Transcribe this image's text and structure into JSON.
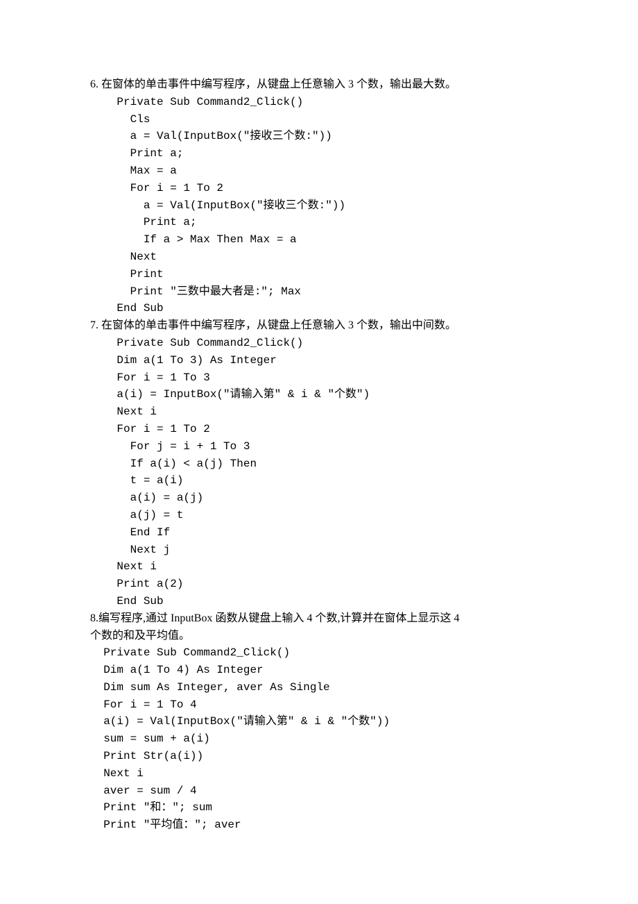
{
  "rows": [
    {
      "indent": 0,
      "cls": "text",
      "text": "6. 在窗体的单击事件中编写程序，从键盘上任意输入 3 个数，输出最大数。"
    },
    {
      "indent": 2,
      "cls": "code",
      "text": "Private Sub Command2_Click()"
    },
    {
      "indent": 3,
      "cls": "code",
      "text": "Cls"
    },
    {
      "indent": 3,
      "cls": "code",
      "text": "a = Val(InputBox(\"接收三个数:\"))"
    },
    {
      "indent": 3,
      "cls": "code",
      "text": "Print a;"
    },
    {
      "indent": 3,
      "cls": "code",
      "text": "Max = a"
    },
    {
      "indent": 3,
      "cls": "code",
      "text": "For i = 1 To 2"
    },
    {
      "indent": 4,
      "cls": "code",
      "text": "a = Val(InputBox(\"接收三个数:\"))"
    },
    {
      "indent": 4,
      "cls": "code",
      "text": "Print a;"
    },
    {
      "indent": 4,
      "cls": "code",
      "text": "If a > Max Then Max = a"
    },
    {
      "indent": 3,
      "cls": "code",
      "text": "Next"
    },
    {
      "indent": 3,
      "cls": "code",
      "text": "Print"
    },
    {
      "indent": 3,
      "cls": "code",
      "text": "Print \"三数中最大者是:\"; Max"
    },
    {
      "indent": 2,
      "cls": "code",
      "text": "End Sub"
    },
    {
      "indent": 0,
      "cls": "text",
      "text": "7. 在窗体的单击事件中编写程序，从键盘上任意输入 3 个数，输出中间数。"
    },
    {
      "indent": 2,
      "cls": "code",
      "text": "Private Sub Command2_Click()"
    },
    {
      "indent": 2,
      "cls": "code",
      "text": "Dim a(1 To 3) As Integer"
    },
    {
      "indent": 2,
      "cls": "code",
      "text": "For i = 1 To 3"
    },
    {
      "indent": 2,
      "cls": "code",
      "text": "a(i) = InputBox(\"请输入第\" & i & \"个数\")"
    },
    {
      "indent": 2,
      "cls": "code",
      "text": "Next i"
    },
    {
      "indent": 2,
      "cls": "code",
      "text": "For i = 1 To 2"
    },
    {
      "indent": 3,
      "cls": "code",
      "text": "For j = i + 1 To 3"
    },
    {
      "indent": 3,
      "cls": "code",
      "text": "If a(i) < a(j) Then"
    },
    {
      "indent": 3,
      "cls": "code",
      "text": "t = a(i)"
    },
    {
      "indent": 3,
      "cls": "code",
      "text": "a(i) = a(j)"
    },
    {
      "indent": 3,
      "cls": "code",
      "text": "a(j) = t"
    },
    {
      "indent": 3,
      "cls": "code",
      "text": "End If"
    },
    {
      "indent": 3,
      "cls": "code",
      "text": "Next j"
    },
    {
      "indent": 2,
      "cls": "code",
      "text": "Next i"
    },
    {
      "indent": 2,
      "cls": "code",
      "text": "Print a(2)"
    },
    {
      "indent": 2,
      "cls": "code",
      "text": "End Sub"
    },
    {
      "indent": 0,
      "cls": "text",
      "text": "8.编写程序,通过 InputBox 函数从键盘上输入 4 个数,计算并在窗体上显示这 4"
    },
    {
      "indent": 0,
      "cls": "text",
      "text": "个数的和及平均值。"
    },
    {
      "indent": 1,
      "cls": "code",
      "text": "Private Sub Command2_Click()"
    },
    {
      "indent": 1,
      "cls": "code",
      "text": "Dim a(1 To 4) As Integer"
    },
    {
      "indent": 1,
      "cls": "code",
      "text": "Dim sum As Integer, aver As Single"
    },
    {
      "indent": 1,
      "cls": "code",
      "text": "For i = 1 To 4"
    },
    {
      "indent": 1,
      "cls": "code",
      "text": "a(i) = Val(InputBox(\"请输入第\" & i & \"个数\"))"
    },
    {
      "indent": 1,
      "cls": "code",
      "text": "sum = sum + a(i)"
    },
    {
      "indent": 1,
      "cls": "code",
      "text": "Print Str(a(i))"
    },
    {
      "indent": 1,
      "cls": "code",
      "text": "Next i"
    },
    {
      "indent": 1,
      "cls": "code",
      "text": "aver = sum / 4"
    },
    {
      "indent": 1,
      "cls": "code",
      "text": "Print \"和：\"; sum"
    },
    {
      "indent": 1,
      "cls": "code",
      "text": "Print \"平均值：\"; aver"
    }
  ],
  "indent_spaces": {
    "0": "",
    "1": "  ",
    "2": "    ",
    "3": "      ",
    "4": "        "
  }
}
